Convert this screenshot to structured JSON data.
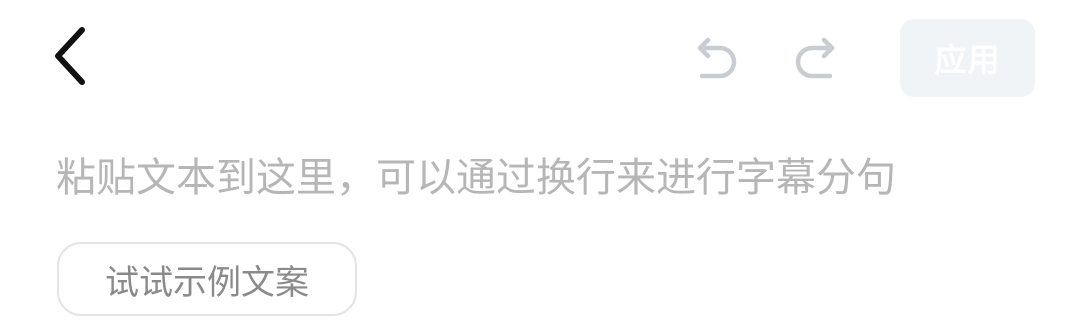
{
  "toolbar": {
    "back_icon": "chevron-left-icon",
    "undo_icon": "undo-icon",
    "redo_icon": "redo-icon",
    "apply_label": "应用",
    "apply_enabled": false
  },
  "editor": {
    "placeholder": "粘贴文本到这里，可以通过换行来进行字幕分句"
  },
  "sample": {
    "label": "试试示例文案"
  },
  "colors": {
    "icon_dark": "#111111",
    "icon_disabled": "#c9ccd0",
    "apply_bg_disabled": "#f1f4f6",
    "placeholder_text": "#b6b6b6",
    "sample_border": "#e4e4e4",
    "sample_text": "#8a8a8a"
  }
}
